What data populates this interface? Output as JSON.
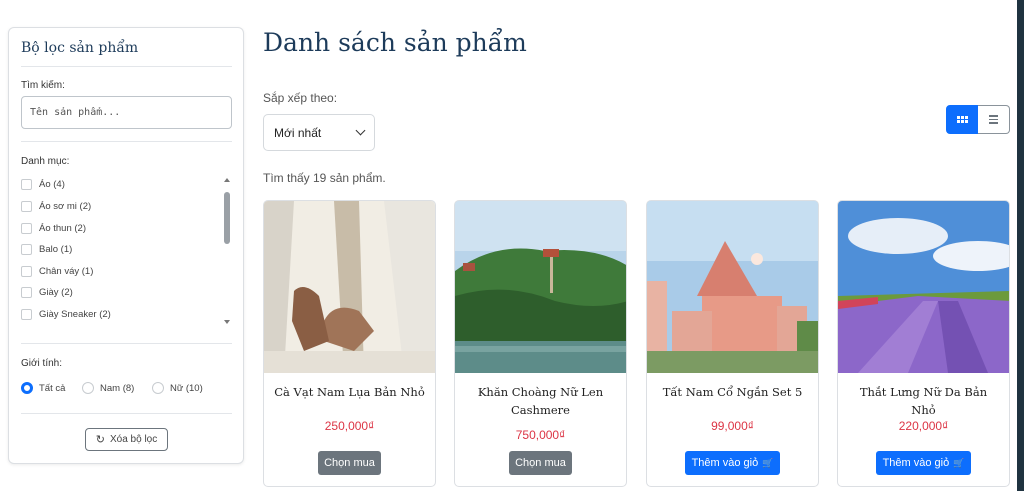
{
  "sidebar": {
    "title": "Bộ lọc sản phẩm",
    "search_label": "Tìm kiếm:",
    "search_placeholder": "Tên sản phẩm...",
    "category_label": "Danh mục:",
    "categories": [
      "Áo (4)",
      "Áo sơ mi (2)",
      "Áo thun (2)",
      "Balo (1)",
      "Chân váy (1)",
      "Giày (2)",
      "Giày Sneaker (2)"
    ],
    "gender_label": "Giới tính:",
    "genders": [
      "Tất cả",
      "Nam (8)",
      "Nữ (10)"
    ],
    "clear_button": "Xóa bộ lọc"
  },
  "main": {
    "title": "Danh sách sản phẩm",
    "sort_label": "Sắp xếp theo:",
    "sort_value": "Mới nhất",
    "found_text": "Tìm thấy 19 sản phẩm.",
    "products": [
      {
        "name": "Cà Vạt Nam Lụa Bản Nhỏ",
        "price": "250,000₫",
        "button": "Chọn mua"
      },
      {
        "name": "Khăn Choàng Nữ Len Cashmere",
        "price": "750,000₫",
        "button": "Chọn mua"
      },
      {
        "name": "Tất Nam Cổ Ngắn Set 5",
        "price": "99,000₫",
        "button": "Thêm vào giỏ"
      },
      {
        "name": "Thắt Lưng Nữ Da Bản Nhỏ",
        "price": "220,000₫",
        "button": "Thêm vào giỏ"
      }
    ]
  },
  "colors": {
    "primary": "#0d6efd",
    "secondary": "#6c757d",
    "price": "#dc3545",
    "heading": "#1d3b5a"
  },
  "icons": [
    "refresh-icon",
    "chevron-down-icon",
    "grid-view-icon",
    "list-view-icon",
    "cart-icon"
  ]
}
